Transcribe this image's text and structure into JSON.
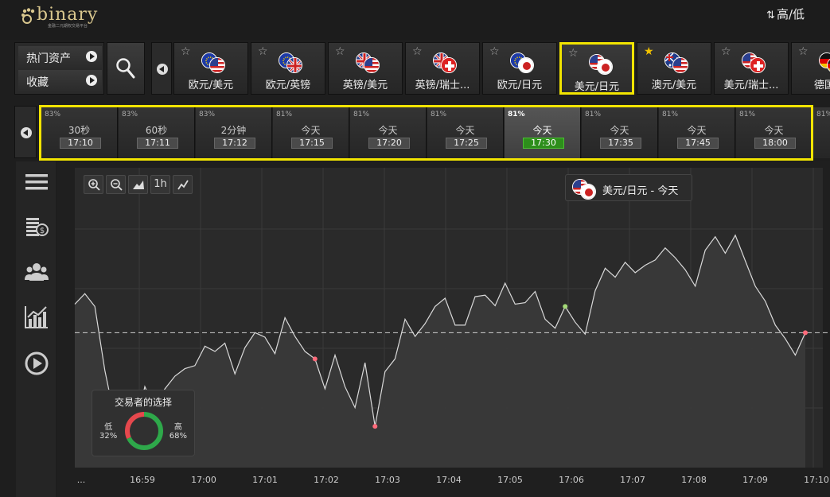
{
  "header": {
    "logo_text": "binary",
    "logo_subtitle": "金融二元期权交易平台",
    "mode_label": "高/低"
  },
  "side_menu": {
    "popular_label": "热门资产",
    "favorites_label": "收藏"
  },
  "assets": [
    {
      "label": "欧元/美元",
      "flags": [
        "eu",
        "us"
      ],
      "favorite": false,
      "selected": false
    },
    {
      "label": "欧元/英镑",
      "flags": [
        "eu",
        "gb"
      ],
      "favorite": false,
      "selected": false
    },
    {
      "label": "英镑/美元",
      "flags": [
        "gb",
        "us"
      ],
      "favorite": false,
      "selected": false
    },
    {
      "label": "英镑/瑞士...",
      "flags": [
        "gb",
        "ch"
      ],
      "favorite": false,
      "selected": false
    },
    {
      "label": "欧元/日元",
      "flags": [
        "eu",
        "jp"
      ],
      "favorite": false,
      "selected": false
    },
    {
      "label": "美元/日元",
      "flags": [
        "us",
        "jp"
      ],
      "favorite": false,
      "selected": true
    },
    {
      "label": "澳元/美元",
      "flags": [
        "au",
        "us"
      ],
      "favorite": true,
      "selected": false
    },
    {
      "label": "美元/瑞士...",
      "flags": [
        "us",
        "ch"
      ],
      "favorite": false,
      "selected": false
    },
    {
      "label": "德国D",
      "flags": [
        "de",
        "de"
      ],
      "favorite": false,
      "selected": false
    }
  ],
  "expiries": [
    {
      "payout": "83%",
      "name": "30秒",
      "time": "17:10",
      "selected": false
    },
    {
      "payout": "83%",
      "name": "60秒",
      "time": "17:11",
      "selected": false
    },
    {
      "payout": "83%",
      "name": "2分钟",
      "time": "17:12",
      "selected": false
    },
    {
      "payout": "81%",
      "name": "今天",
      "time": "17:15",
      "selected": false
    },
    {
      "payout": "81%",
      "name": "今天",
      "time": "17:20",
      "selected": false
    },
    {
      "payout": "81%",
      "name": "今天",
      "time": "17:25",
      "selected": false
    },
    {
      "payout": "81%",
      "name": "今天",
      "time": "17:30",
      "selected": true
    },
    {
      "payout": "81%",
      "name": "今天",
      "time": "17:35",
      "selected": false
    },
    {
      "payout": "81%",
      "name": "今天",
      "time": "17:45",
      "selected": false
    },
    {
      "payout": "81%",
      "name": "今天",
      "time": "18:00",
      "selected": false
    },
    {
      "payout": "81%",
      "name": "",
      "time": "",
      "selected": false
    }
  ],
  "chart_tools": [
    "zoom-in",
    "zoom-out",
    "chart-type",
    "1h",
    "indicator"
  ],
  "chart_tool_labels": {
    "timeframe": "1h"
  },
  "chart_legend": "美元/日元 - 今天",
  "traders_choice": {
    "title": "交易者的选择",
    "low_label": "低",
    "low_pct": "32%",
    "high_label": "高",
    "high_pct": "68%",
    "low_value": 32,
    "high_value": 68
  },
  "colors": {
    "accent_yellow": "#f2e400",
    "selected_green": "#2d8e1b",
    "low_red": "#e5484d",
    "high_green": "#2ea84a",
    "line": "#d9d9d9"
  },
  "chart_data": {
    "type": "area",
    "x_ticks": [
      "...",
      "16:59",
      "17:00",
      "17:01",
      "17:02",
      "17:03",
      "17:04",
      "17:05",
      "17:06",
      "17:07",
      "17:08",
      "17:09",
      "17:10"
    ],
    "y": [
      0.38,
      0.52,
      0.35,
      -0.5,
      -1.15,
      -0.9,
      -1.3,
      -0.72,
      -1.02,
      -0.75,
      -0.58,
      -0.48,
      -0.44,
      -0.18,
      -0.25,
      -0.14,
      -0.55,
      -0.2,
      0.0,
      -0.06,
      -0.28,
      0.2,
      -0.05,
      -0.25,
      -0.35,
      -0.75,
      -0.3,
      -0.72,
      -1.0,
      -0.4,
      -1.25,
      -0.52,
      -0.35,
      0.18,
      -0.05,
      0.12,
      0.35,
      0.46,
      0.1,
      0.1,
      0.48,
      0.5,
      0.36,
      0.66,
      0.38,
      0.4,
      0.55,
      0.18,
      0.06,
      0.35,
      0.14,
      -0.02,
      0.56,
      0.86,
      0.74,
      0.94,
      0.8,
      0.9,
      0.97,
      1.13,
      1.0,
      0.84,
      0.62,
      1.1,
      1.28,
      1.06,
      1.3,
      0.96,
      0.62,
      0.42,
      0.1,
      -0.08,
      -0.3,
      0.0
    ],
    "baseline": 0.0,
    "markers": [
      {
        "index": 24,
        "color": "#ff6b7b"
      },
      {
        "index": 30,
        "color": "#ff6b7b"
      },
      {
        "index": 49,
        "color": "#a3d977"
      },
      {
        "index": 73,
        "color": "#ff6b7b"
      }
    ],
    "ylim": [
      -1.8,
      2.2
    ],
    "grid": true
  }
}
